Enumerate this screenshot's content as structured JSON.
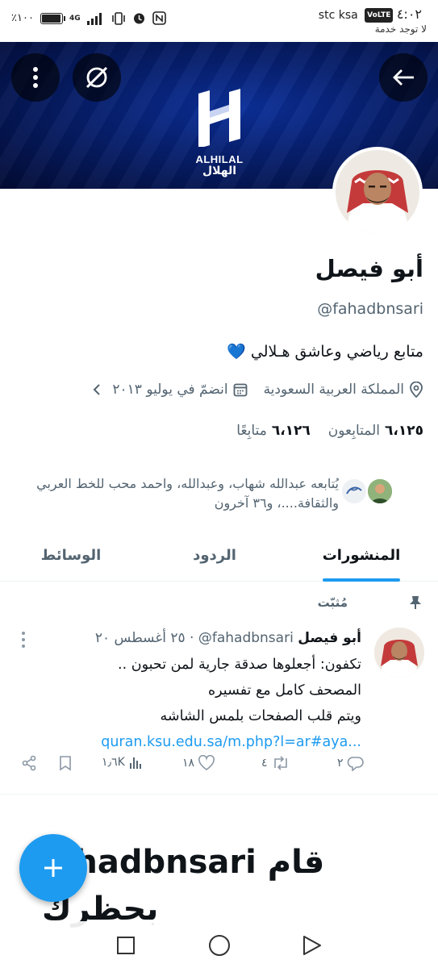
{
  "status_bar": {
    "time": "٤:٠٢",
    "volte": "VoLTE",
    "carrier": "stc ksa",
    "no_service": "لا توجد خدمة",
    "battery": "٪١٠٠",
    "battery_level": 1.0,
    "network": "4G"
  },
  "banner": {
    "logo_en": "ALHILAL",
    "logo_ar": "الهلال",
    "colors": {
      "dark": "#020b33",
      "mid": "#0b2f9a"
    }
  },
  "profile": {
    "name": "أبو فيصل",
    "handle": "@fahadbnsari",
    "bio": "متابع رياضي وعاشق هـلالي 💙",
    "location": "المملكة العربية السعودية",
    "joined": "انضمّ في يوليو ٢٠١٣",
    "followers_count": "٦،١٢٥",
    "followers_label": "المتابِعون",
    "following_count": "٦،١٢٦",
    "following_label": "متابِعًا",
    "followed_by_line1": "يُتابعه عبدالله شهاب، وعبدالله، واحمد محب للخط العربي",
    "followed_by_line2": "والثقافة....، و٣٦ آخرون"
  },
  "tabs": [
    {
      "label": "المنشورات",
      "active": true
    },
    {
      "label": "الردود",
      "active": false
    },
    {
      "label": "الوسائط",
      "active": false
    }
  ],
  "pinned_tweet": {
    "pinned_label": "مُثبّت",
    "author": "أبو فيصل",
    "handle": "@fahadbnsari",
    "separator": "·",
    "date": "٢٥ أغسطس ٢٠",
    "line1": "تكفون: أجعلوها صدقة جارية لمن تحبون ..",
    "line2": "المصحف كامل مع تفسيره",
    "line3": "ويتم قلب الصفحات بلمس الشاشه",
    "link": "quran.ksu.edu.sa/m.php?l=ar#aya...",
    "replies": "٢",
    "retweets": "٤",
    "likes": "١٨",
    "views": "١٫٦K"
  },
  "blocked_card": {
    "line1_word": "قام",
    "line1_handle": "fahadbnsari",
    "line2": "بحظرك"
  },
  "accent_color": "#1d9bf0"
}
